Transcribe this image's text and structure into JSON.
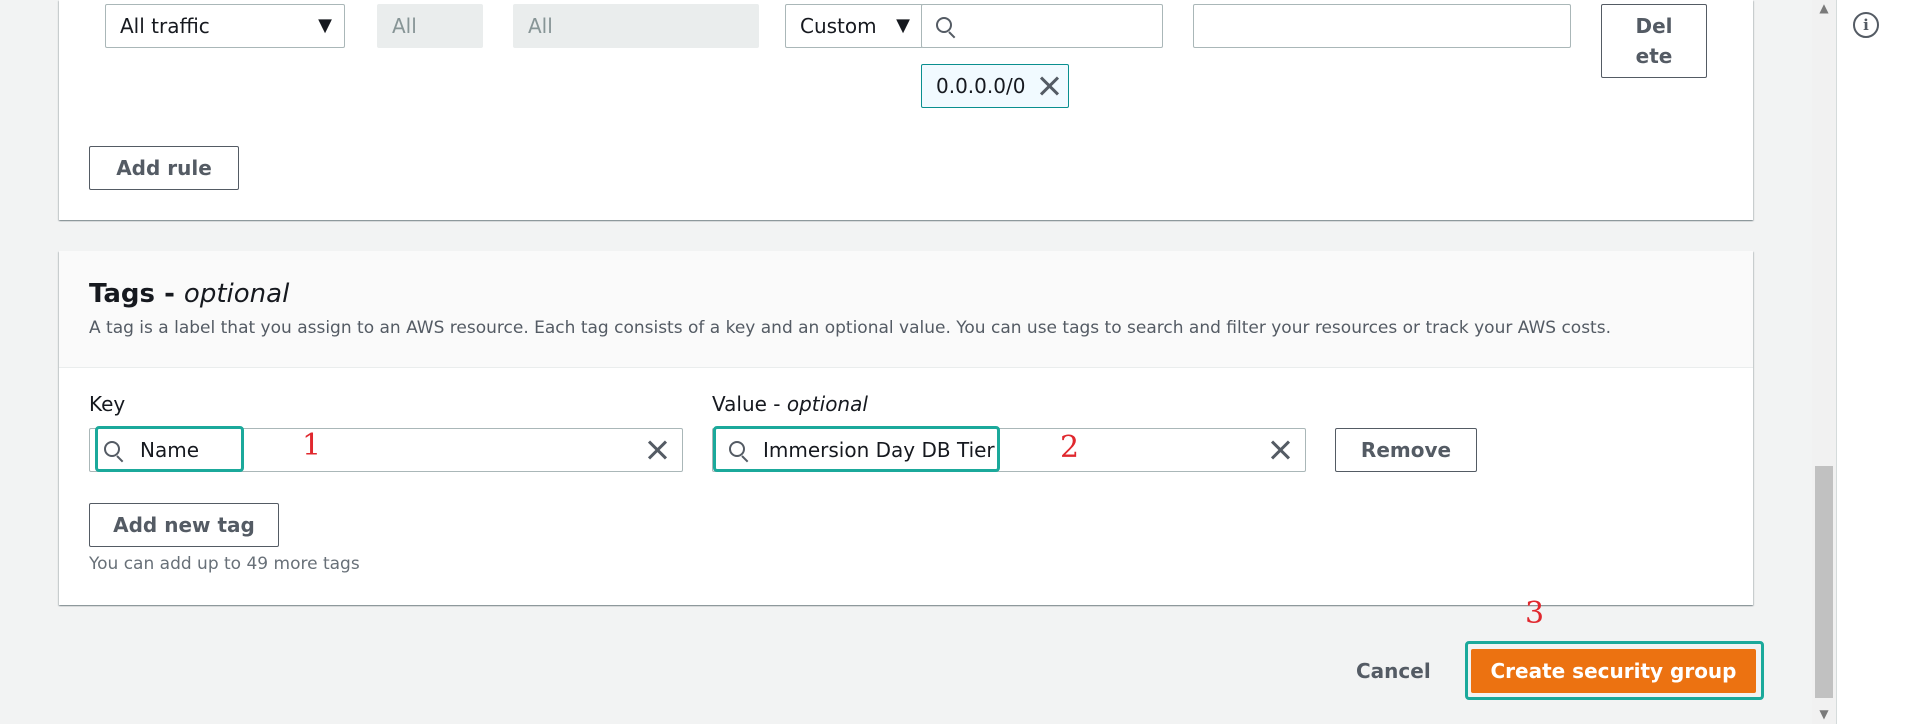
{
  "rule_row": {
    "type_value": "All traffic",
    "protocol_value": "All",
    "port_range_value": "All",
    "source_type_value": "Custom",
    "source_search_placeholder": "",
    "source_token": "0.0.0.0/0",
    "description_value": "",
    "delete_label_line1": "Del",
    "delete_label_line2": "ete"
  },
  "add_rule_label": "Add rule",
  "tags": {
    "title": "Tags - ",
    "title_optional": "optional",
    "description": "A tag is a label that you assign to an AWS resource. Each tag consists of a key and an optional value. You can use tags to search and filter your resources or track your AWS costs.",
    "key_label": "Key",
    "value_label": "Value - ",
    "value_label_optional": "optional",
    "key_value": "Name",
    "value_value": "Immersion Day DB Tier",
    "remove_label": "Remove",
    "add_new_tag_label": "Add new tag",
    "hint": "You can add up to 49 more tags"
  },
  "annotations": {
    "step1": "1",
    "step2": "2",
    "step3": "3"
  },
  "footer": {
    "cancel_label": "Cancel",
    "create_label": "Create security group"
  },
  "colors": {
    "primary": "#ec7211",
    "highlight": "#1ba99b",
    "annotation": "#e0282e"
  },
  "icons": {
    "info": "info-icon",
    "search": "search-icon",
    "clear": "close-icon",
    "dropdown": "caret-down-icon"
  }
}
